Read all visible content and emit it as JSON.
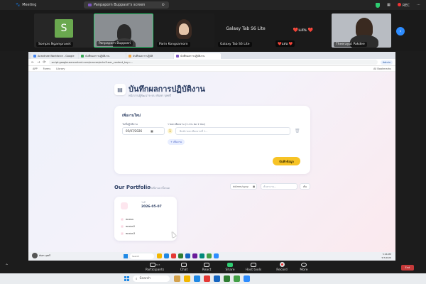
{
  "zoom_top": {
    "meeting_label": "Meeting",
    "share_label": "Panpaporn Buppasri's screen",
    "rec_label": "REC"
  },
  "gallery": {
    "participants": [
      {
        "name": "Sompis Ngampraset",
        "initial": "S"
      },
      {
        "name": "Panpaporn Buppasri"
      },
      {
        "name": "Parin Kongsamorn"
      },
      {
        "name": "Galaxy Tab S6 Lite",
        "center_label": "Galaxy Tab S6 Lite"
      },
      {
        "name": "❤️แสน ❤️",
        "center_label": "❤️แสน ❤️"
      },
      {
        "name": "Theerayut Pakdee"
      }
    ]
  },
  "browser": {
    "tabs": [
      {
        "label": "Anantnee Workforce - Google"
      },
      {
        "label": "บันทึกผลการปฏิบัติงาน"
      },
      {
        "label": "บันทึกผลการปฏิบัติ"
      },
      {
        "label": "บันทึกผลการปฏิบัติงาน"
      }
    ],
    "url": "script.googleusercontent.com/macros/echo?user_content_key=...",
    "profile": "Admin",
    "bookmarks": [
      "APP",
      "Forms",
      "Library"
    ],
    "all_bookmarks": "All Bookmarks"
  },
  "app": {
    "title": "บันทึกผลการปฏิบัติงาน",
    "subtitle": "พนักงานผู้พัฒนาระบบ พันพร บุพศรี",
    "form": {
      "title": "เพิ่มงานใหม่",
      "date_label": "วันที่ปฏิบัติงาน",
      "date_value": "05/07/2026",
      "tasks_label": "รายละเอียดงาน (1 งาน ต่อ 1 ช่อง)",
      "task_number": "1",
      "task_placeholder": "พิมพ์รายละเอียดงานที่ 1...",
      "add_label": "+ เพิ่มงาน",
      "save_label": "บันทึกข้อมูล"
    },
    "portfolio": {
      "title": "Our Portfolio",
      "subtitle": "ผลงานที่ผ่านมาทั้งหมด",
      "date_placeholder": "dd/mm/yyyy",
      "search_placeholder": "ค้นหางาน...",
      "search_button": "ค้น",
      "card": {
        "day": "วันที่",
        "date": "2026-05-07",
        "items": [
          "ทดสอบ",
          "ทดสอบ2",
          "ทดสอบ3"
        ]
      }
    }
  },
  "inner_taskbar": {
    "user_name": "พันพร บุพศรี",
    "search": "Search",
    "time": "5:06 PM",
    "date": "5/7/2026"
  },
  "zoom_bottom": {
    "buttons": [
      {
        "label": "Participants",
        "badge": "303"
      },
      {
        "label": "Chat"
      },
      {
        "label": "React"
      },
      {
        "label": "Share"
      },
      {
        "label": "Host tools"
      },
      {
        "label": "Record"
      },
      {
        "label": "More"
      }
    ],
    "end_label": "End"
  },
  "host_taskbar": {
    "search": "Search"
  }
}
